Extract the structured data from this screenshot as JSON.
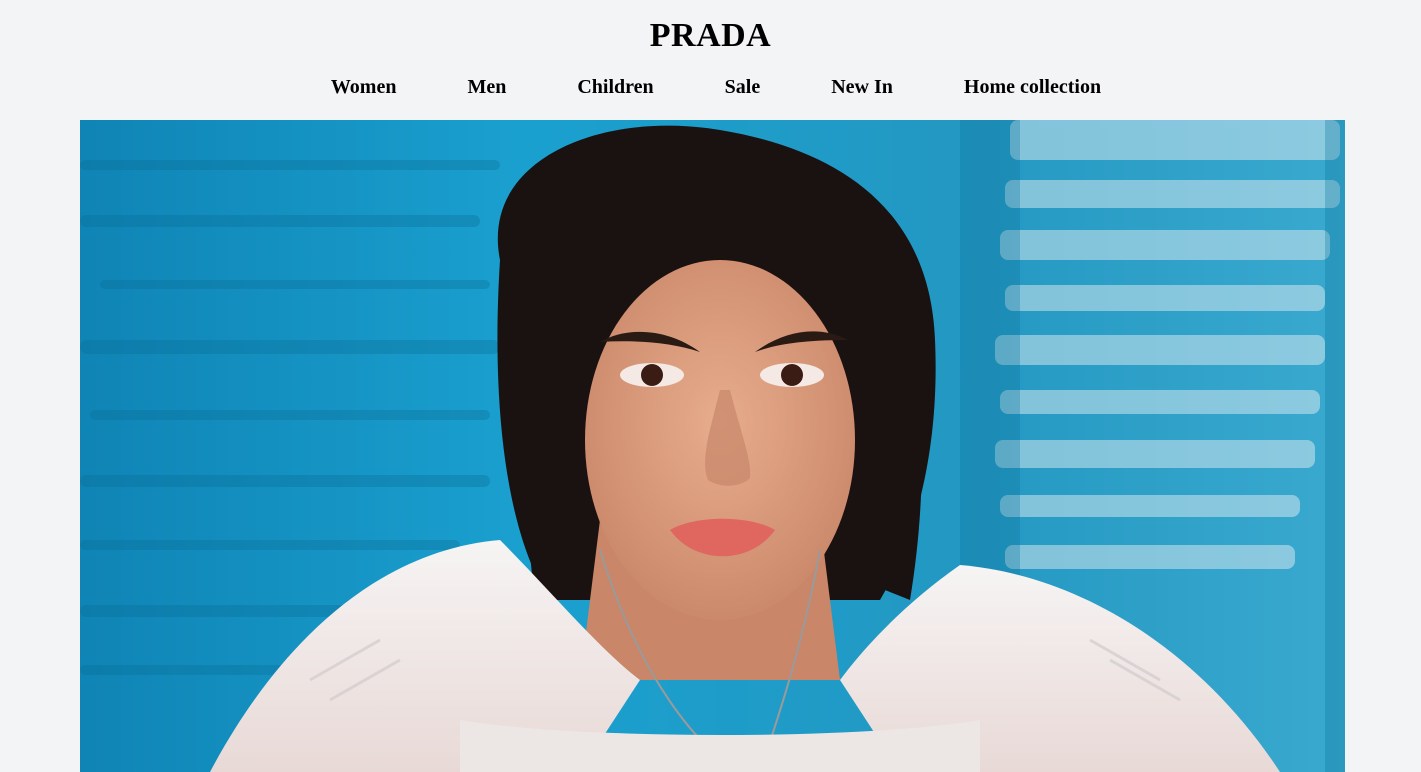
{
  "brand": {
    "logo_text": "PRADA"
  },
  "nav": {
    "items": [
      {
        "label": "Women"
      },
      {
        "label": "Men"
      },
      {
        "label": "Children"
      },
      {
        "label": "Sale"
      },
      {
        "label": "New In"
      },
      {
        "label": "Home collection"
      }
    ]
  },
  "hero": {
    "photo_subject": "woman-in-pool",
    "colors": {
      "pool": "#1596c4",
      "pool_dark": "#0a6f99",
      "pool_light": "#b9dbe8",
      "hair": "#1a1210",
      "skin": "#d99a7c",
      "lips": "#e0675f",
      "shirt": "#f1eeee"
    }
  },
  "colors": {
    "page_background": "#f3f4f6",
    "text": "#000000"
  }
}
